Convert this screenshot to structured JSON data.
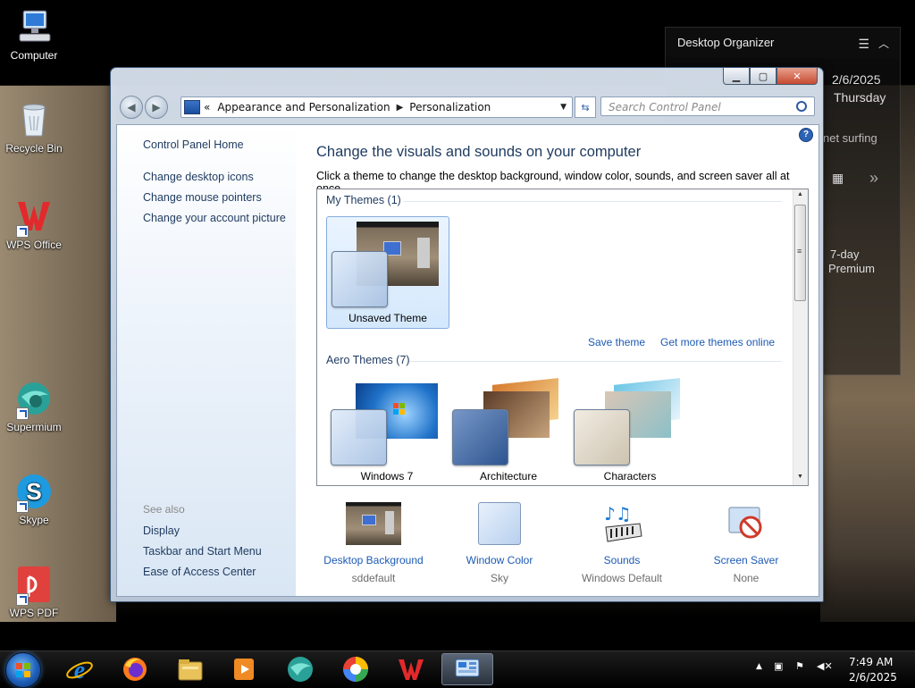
{
  "desktop": {
    "icons": [
      {
        "label": "Computer"
      },
      {
        "label": "Recycle Bin"
      },
      {
        "label": "WPS Office"
      },
      {
        "label": "Supermium"
      },
      {
        "label": "Skype"
      },
      {
        "label": "WPS PDF"
      }
    ]
  },
  "gadget": {
    "title": "Desktop Organizer",
    "date": "2/6/2025",
    "day": "Thursday",
    "fragment_surf": "net surfing",
    "fragment_trial1": "7-day",
    "fragment_trial2": "Premium"
  },
  "window": {
    "breadcrumb": {
      "prefix": "«",
      "items": [
        "Appearance and Personalization",
        "Personalization"
      ]
    },
    "search_placeholder": "Search Control Panel",
    "left_links": [
      "Control Panel Home",
      "Change desktop icons",
      "Change mouse pointers",
      "Change your account picture"
    ],
    "see_also_heading": "See also",
    "see_also": [
      "Display",
      "Taskbar and Start Menu",
      "Ease of Access Center"
    ],
    "title": "Change the visuals and sounds on your computer",
    "subtitle": "Click a theme to change the desktop background, window color, sounds, and screen saver all at once.",
    "my_themes_heading": "My Themes (1)",
    "my_themes": [
      {
        "name": "Unsaved Theme"
      }
    ],
    "save_theme": "Save theme",
    "get_more_themes": "Get more themes online",
    "aero_heading": "Aero Themes (7)",
    "aero_themes": [
      {
        "name": "Windows 7"
      },
      {
        "name": "Architecture"
      },
      {
        "name": "Characters"
      }
    ],
    "bottom": [
      {
        "label": "Desktop Background",
        "value": "sddefault",
        "icon": "desktop-background-icon"
      },
      {
        "label": "Window Color",
        "value": "Sky",
        "icon": "window-color-icon"
      },
      {
        "label": "Sounds",
        "value": "Windows Default",
        "icon": "sounds-icon"
      },
      {
        "label": "Screen Saver",
        "value": "None",
        "icon": "screen-saver-icon"
      }
    ]
  },
  "taskbar": {
    "time": "7:49 AM",
    "date": "2/6/2025",
    "pinned": [
      "internet-explorer-icon",
      "firefox-icon",
      "file-explorer-icon",
      "media-player-icon",
      "supermium-icon",
      "chrome-like-icon",
      "wps-icon",
      "control-panel-icon"
    ]
  }
}
